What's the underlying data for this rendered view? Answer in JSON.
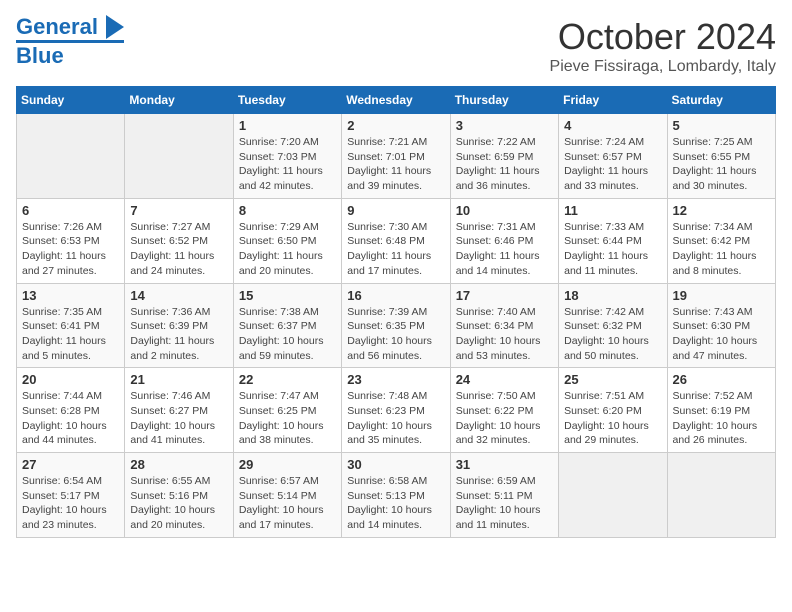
{
  "logo": {
    "line1": "General",
    "line2": "Blue"
  },
  "title": "October 2024",
  "subtitle": "Pieve Fissiraga, Lombardy, Italy",
  "days_of_week": [
    "Sunday",
    "Monday",
    "Tuesday",
    "Wednesday",
    "Thursday",
    "Friday",
    "Saturday"
  ],
  "weeks": [
    [
      {
        "day": "",
        "detail": ""
      },
      {
        "day": "",
        "detail": ""
      },
      {
        "day": "1",
        "detail": "Sunrise: 7:20 AM\nSunset: 7:03 PM\nDaylight: 11 hours and 42 minutes."
      },
      {
        "day": "2",
        "detail": "Sunrise: 7:21 AM\nSunset: 7:01 PM\nDaylight: 11 hours and 39 minutes."
      },
      {
        "day": "3",
        "detail": "Sunrise: 7:22 AM\nSunset: 6:59 PM\nDaylight: 11 hours and 36 minutes."
      },
      {
        "day": "4",
        "detail": "Sunrise: 7:24 AM\nSunset: 6:57 PM\nDaylight: 11 hours and 33 minutes."
      },
      {
        "day": "5",
        "detail": "Sunrise: 7:25 AM\nSunset: 6:55 PM\nDaylight: 11 hours and 30 minutes."
      }
    ],
    [
      {
        "day": "6",
        "detail": "Sunrise: 7:26 AM\nSunset: 6:53 PM\nDaylight: 11 hours and 27 minutes."
      },
      {
        "day": "7",
        "detail": "Sunrise: 7:27 AM\nSunset: 6:52 PM\nDaylight: 11 hours and 24 minutes."
      },
      {
        "day": "8",
        "detail": "Sunrise: 7:29 AM\nSunset: 6:50 PM\nDaylight: 11 hours and 20 minutes."
      },
      {
        "day": "9",
        "detail": "Sunrise: 7:30 AM\nSunset: 6:48 PM\nDaylight: 11 hours and 17 minutes."
      },
      {
        "day": "10",
        "detail": "Sunrise: 7:31 AM\nSunset: 6:46 PM\nDaylight: 11 hours and 14 minutes."
      },
      {
        "day": "11",
        "detail": "Sunrise: 7:33 AM\nSunset: 6:44 PM\nDaylight: 11 hours and 11 minutes."
      },
      {
        "day": "12",
        "detail": "Sunrise: 7:34 AM\nSunset: 6:42 PM\nDaylight: 11 hours and 8 minutes."
      }
    ],
    [
      {
        "day": "13",
        "detail": "Sunrise: 7:35 AM\nSunset: 6:41 PM\nDaylight: 11 hours and 5 minutes."
      },
      {
        "day": "14",
        "detail": "Sunrise: 7:36 AM\nSunset: 6:39 PM\nDaylight: 11 hours and 2 minutes."
      },
      {
        "day": "15",
        "detail": "Sunrise: 7:38 AM\nSunset: 6:37 PM\nDaylight: 10 hours and 59 minutes."
      },
      {
        "day": "16",
        "detail": "Sunrise: 7:39 AM\nSunset: 6:35 PM\nDaylight: 10 hours and 56 minutes."
      },
      {
        "day": "17",
        "detail": "Sunrise: 7:40 AM\nSunset: 6:34 PM\nDaylight: 10 hours and 53 minutes."
      },
      {
        "day": "18",
        "detail": "Sunrise: 7:42 AM\nSunset: 6:32 PM\nDaylight: 10 hours and 50 minutes."
      },
      {
        "day": "19",
        "detail": "Sunrise: 7:43 AM\nSunset: 6:30 PM\nDaylight: 10 hours and 47 minutes."
      }
    ],
    [
      {
        "day": "20",
        "detail": "Sunrise: 7:44 AM\nSunset: 6:28 PM\nDaylight: 10 hours and 44 minutes."
      },
      {
        "day": "21",
        "detail": "Sunrise: 7:46 AM\nSunset: 6:27 PM\nDaylight: 10 hours and 41 minutes."
      },
      {
        "day": "22",
        "detail": "Sunrise: 7:47 AM\nSunset: 6:25 PM\nDaylight: 10 hours and 38 minutes."
      },
      {
        "day": "23",
        "detail": "Sunrise: 7:48 AM\nSunset: 6:23 PM\nDaylight: 10 hours and 35 minutes."
      },
      {
        "day": "24",
        "detail": "Sunrise: 7:50 AM\nSunset: 6:22 PM\nDaylight: 10 hours and 32 minutes."
      },
      {
        "day": "25",
        "detail": "Sunrise: 7:51 AM\nSunset: 6:20 PM\nDaylight: 10 hours and 29 minutes."
      },
      {
        "day": "26",
        "detail": "Sunrise: 7:52 AM\nSunset: 6:19 PM\nDaylight: 10 hours and 26 minutes."
      }
    ],
    [
      {
        "day": "27",
        "detail": "Sunrise: 6:54 AM\nSunset: 5:17 PM\nDaylight: 10 hours and 23 minutes."
      },
      {
        "day": "28",
        "detail": "Sunrise: 6:55 AM\nSunset: 5:16 PM\nDaylight: 10 hours and 20 minutes."
      },
      {
        "day": "29",
        "detail": "Sunrise: 6:57 AM\nSunset: 5:14 PM\nDaylight: 10 hours and 17 minutes."
      },
      {
        "day": "30",
        "detail": "Sunrise: 6:58 AM\nSunset: 5:13 PM\nDaylight: 10 hours and 14 minutes."
      },
      {
        "day": "31",
        "detail": "Sunrise: 6:59 AM\nSunset: 5:11 PM\nDaylight: 10 hours and 11 minutes."
      },
      {
        "day": "",
        "detail": ""
      },
      {
        "day": "",
        "detail": ""
      }
    ]
  ]
}
